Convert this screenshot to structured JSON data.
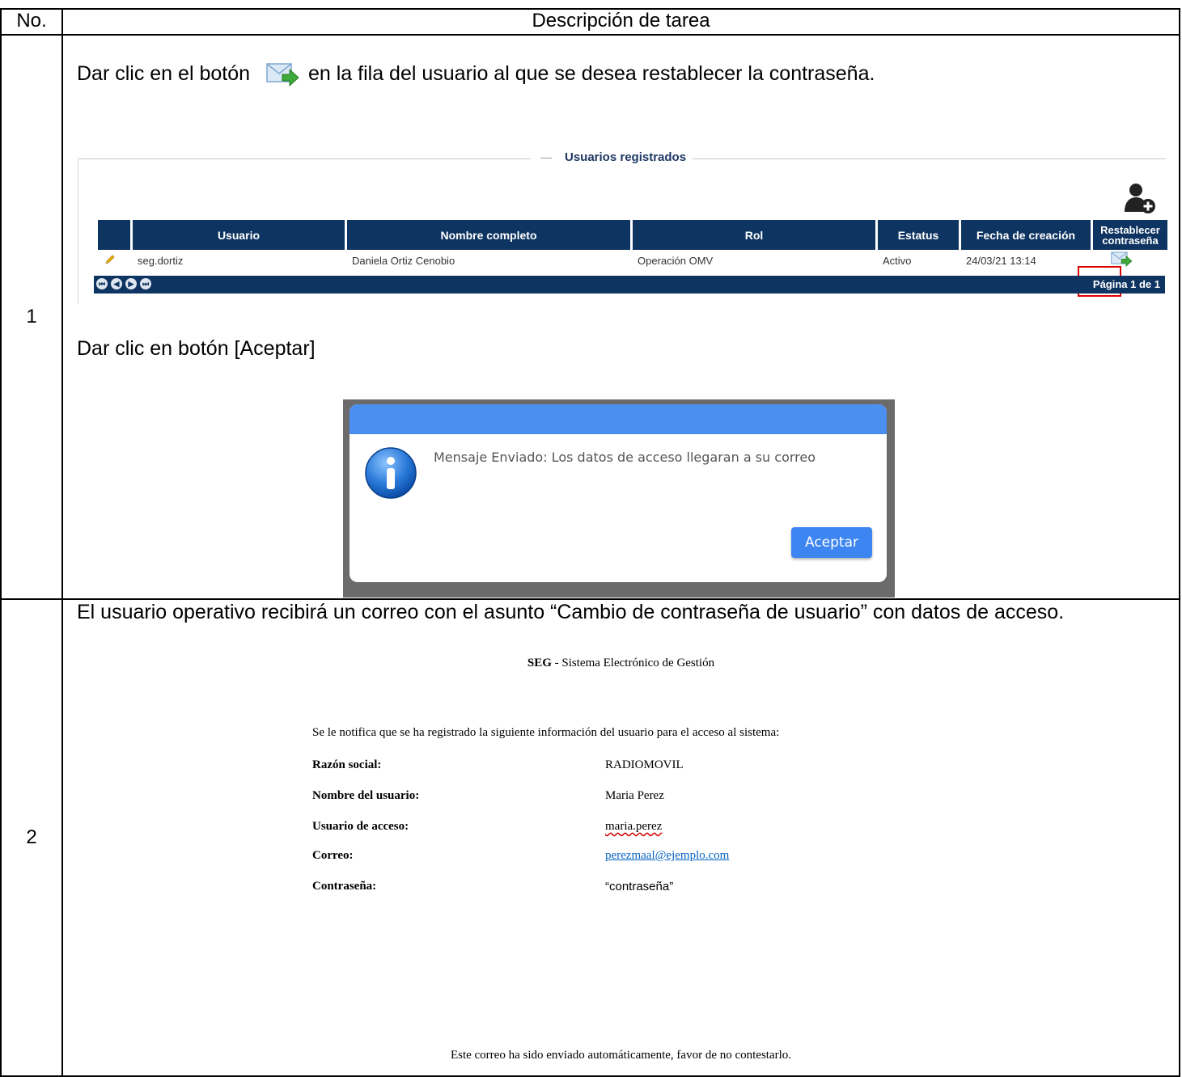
{
  "table": {
    "header_no": "No.",
    "header_desc": "Descripción de tarea"
  },
  "step1": {
    "number": "1",
    "instruction_a_before": "Dar clic en el botón",
    "instruction_a_after": "en la fila del usuario al que se desea restablecer la contraseña.",
    "instruction_b": "Dar clic en botón  [Aceptar]",
    "panel": {
      "title": "Usuarios registrados",
      "columns": [
        "",
        "Usuario",
        "Nombre completo",
        "Rol",
        "Estatus",
        "Fecha de creación",
        "Restablecer contraseña"
      ],
      "rows": [
        {
          "usuario": "seg.dortiz",
          "nombre": "Daniela Ortiz Cenobio",
          "rol": "Operación OMV",
          "estatus": "Activo",
          "fecha": "24/03/21 13:14"
        }
      ],
      "pager_text": "Página 1 de 1"
    },
    "dialog": {
      "message": "Mensaje Enviado: Los datos de acceso llegaran a su correo",
      "accept_label": "Aceptar"
    }
  },
  "step2": {
    "number": "2",
    "instruction": "El usuario operativo recibirá un correo con el asunto “Cambio de contraseña de usuario” con datos de acceso.",
    "email": {
      "title_bold": "SEG",
      "title_rest": " - Sistema Electrónico de Gestión",
      "notice": "Se le notifica que se ha registrado la siguiente información del usuario para el acceso al sistema:",
      "fields": [
        {
          "label": "Razón social:",
          "value": "RADIOMOVIL"
        },
        {
          "label": "Nombre del usuario:",
          "value": "Maria Perez"
        },
        {
          "label": "Usuario de acceso:",
          "value": "maria.perez"
        },
        {
          "label": "Correo:",
          "value": "perezmaal@ejemplo.com"
        },
        {
          "label": "Contraseña:",
          "value": "“contraseña”"
        }
      ],
      "footer": "Este correo ha sido enviado automáticamente, favor de no contestarlo."
    }
  },
  "colors": {
    "grid_header": "#0e3461",
    "dialog_bar": "#4b8ff0",
    "accept_button": "#3d86f2",
    "highlight": "#e00000",
    "link": "#0563c1"
  },
  "icons": [
    "resend-mail-icon",
    "add-user-icon",
    "edit-pencil-icon",
    "info-icon",
    "pager-first-icon",
    "pager-prev-icon",
    "pager-next-icon",
    "pager-last-icon"
  ]
}
